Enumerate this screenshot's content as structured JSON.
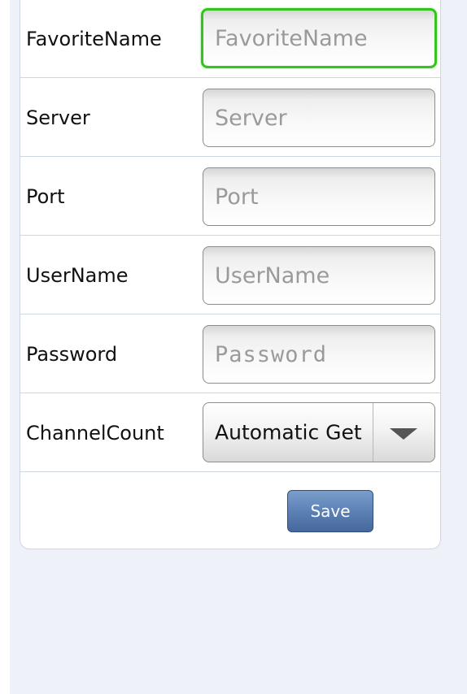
{
  "form": {
    "fields": [
      {
        "label": "FavoriteName",
        "placeholder": "FavoriteName"
      },
      {
        "label": "Server",
        "placeholder": "Server"
      },
      {
        "label": "Port",
        "placeholder": "Port"
      },
      {
        "label": "UserName",
        "placeholder": "UserName"
      },
      {
        "label": "Password",
        "placeholder": "Password"
      }
    ],
    "channel_count": {
      "label": "ChannelCount",
      "selected": "Automatic Get",
      "icon": "dropdown-arrow-icon"
    },
    "save_label": "Save"
  },
  "colors": {
    "focus_border": "#35c41e",
    "save_button": "#5f84b8",
    "page_background": "#eef2f8",
    "divider": "#cfd6e3"
  }
}
